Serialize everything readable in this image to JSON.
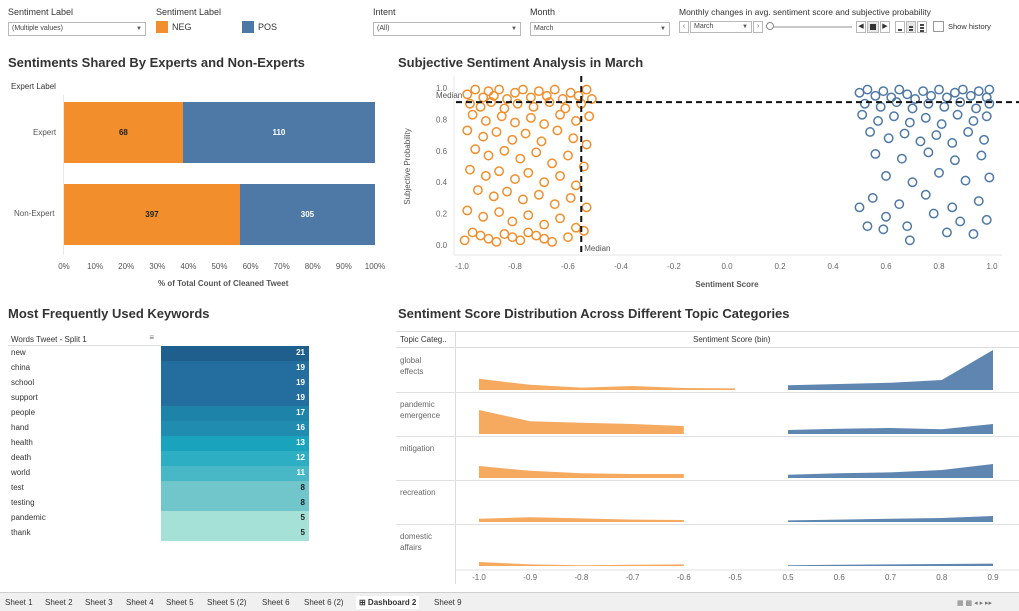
{
  "filters": {
    "sentiment_filter": {
      "label": "Sentiment Label",
      "value": "(Multiple values)"
    },
    "legend": {
      "label": "Sentiment Label",
      "items": [
        {
          "name": "NEG",
          "color": "#f28e2b"
        },
        {
          "name": "POS",
          "color": "#4e79a7"
        }
      ]
    },
    "intent": {
      "label": "Intent",
      "value": "(All)"
    },
    "month": {
      "label": "Month",
      "value": "March"
    },
    "monthly": {
      "label": "Monthly changes in avg. sentiment score and subjective probability",
      "value": "March",
      "show_history": "Show history"
    }
  },
  "panel1": {
    "title": "Sentiments Shared By Experts and Non-Experts",
    "row_header": "Expert Label",
    "xlabel": "% of Total Count of Cleaned Tweet"
  },
  "panel2": {
    "title": "Subjective Sentiment Analysis in March",
    "ylabel": "Subjective Probability",
    "xlabel": "Sentiment Score",
    "median_label_h": "Median",
    "median_label_v": "Median"
  },
  "panel3": {
    "title": "Most Frequently Used Keywords",
    "col_header": "Words Tweet - Split 1"
  },
  "panel4": {
    "title": "Sentiment Score Distribution Across Different Topic Categories",
    "row_header": "Topic Categ..",
    "col_header": "Sentiment Score (bin)",
    "topics": [
      [
        "global",
        "effects"
      ],
      [
        "pandemic",
        "emergence"
      ],
      [
        "mitigation"
      ],
      [
        "recreation"
      ],
      [
        "domestic",
        "affairs"
      ]
    ]
  },
  "chart_data": [
    {
      "type": "bar",
      "title": "Sentiments Shared By Experts and Non-Experts",
      "xlabel": "% of Total Count of Cleaned Tweet",
      "categories": [
        "Expert",
        "Non-Expert"
      ],
      "series": [
        {
          "name": "NEG",
          "values": [
            68,
            397
          ]
        },
        {
          "name": "POS",
          "values": [
            110,
            305
          ]
        }
      ],
      "ticks": [
        "0%",
        "10%",
        "20%",
        "30%",
        "40%",
        "50%",
        "60%",
        "70%",
        "80%",
        "90%",
        "100%"
      ],
      "stacked": "percent"
    },
    {
      "type": "scatter",
      "title": "Subjective Sentiment Analysis in March",
      "xlabel": "Sentiment Score",
      "ylabel": "Subjective Probability",
      "xlim": [
        -1.0,
        1.0
      ],
      "ylim": [
        0.0,
        1.0
      ],
      "x_ticks": [
        "-1.0",
        "-0.8",
        "-0.6",
        "-0.4",
        "-0.2",
        "0.0",
        "0.2",
        "0.4",
        "0.6",
        "0.8",
        "1.0"
      ],
      "y_ticks": [
        "0.0",
        "0.2",
        "0.4",
        "0.6",
        "0.8",
        "1.0"
      ],
      "median_x": -0.55,
      "median_y": 0.91,
      "series": [
        {
          "name": "NEG",
          "points": [
            [
              -0.98,
              0.96
            ],
            [
              -0.95,
              0.99
            ],
            [
              -0.92,
              0.94
            ],
            [
              -0.9,
              0.98
            ],
            [
              -0.88,
              0.95
            ],
            [
              -0.86,
              0.99
            ],
            [
              -0.83,
              0.93
            ],
            [
              -0.8,
              0.97
            ],
            [
              -0.77,
              0.99
            ],
            [
              -0.74,
              0.94
            ],
            [
              -0.71,
              0.98
            ],
            [
              -0.68,
              0.95
            ],
            [
              -0.65,
              0.99
            ],
            [
              -0.62,
              0.93
            ],
            [
              -0.59,
              0.97
            ],
            [
              -0.56,
              0.95
            ],
            [
              -0.53,
              0.99
            ],
            [
              -0.51,
              0.93
            ],
            [
              -0.97,
              0.9
            ],
            [
              -0.93,
              0.88
            ],
            [
              -0.89,
              0.91
            ],
            [
              -0.84,
              0.87
            ],
            [
              -0.79,
              0.9
            ],
            [
              -0.73,
              0.88
            ],
            [
              -0.67,
              0.91
            ],
            [
              -0.61,
              0.87
            ],
            [
              -0.55,
              0.9
            ],
            [
              -0.96,
              0.83
            ],
            [
              -0.91,
              0.79
            ],
            [
              -0.85,
              0.82
            ],
            [
              -0.8,
              0.78
            ],
            [
              -0.74,
              0.81
            ],
            [
              -0.69,
              0.77
            ],
            [
              -0.63,
              0.83
            ],
            [
              -0.57,
              0.79
            ],
            [
              -0.52,
              0.82
            ],
            [
              -0.98,
              0.73
            ],
            [
              -0.92,
              0.69
            ],
            [
              -0.87,
              0.72
            ],
            [
              -0.81,
              0.67
            ],
            [
              -0.76,
              0.71
            ],
            [
              -0.7,
              0.66
            ],
            [
              -0.64,
              0.73
            ],
            [
              -0.58,
              0.68
            ],
            [
              -0.53,
              0.64
            ],
            [
              -0.95,
              0.61
            ],
            [
              -0.9,
              0.57
            ],
            [
              -0.84,
              0.6
            ],
            [
              -0.78,
              0.55
            ],
            [
              -0.72,
              0.59
            ],
            [
              -0.66,
              0.52
            ],
            [
              -0.6,
              0.57
            ],
            [
              -0.54,
              0.5
            ],
            [
              -0.97,
              0.48
            ],
            [
              -0.91,
              0.44
            ],
            [
              -0.86,
              0.47
            ],
            [
              -0.8,
              0.42
            ],
            [
              -0.75,
              0.46
            ],
            [
              -0.69,
              0.4
            ],
            [
              -0.63,
              0.44
            ],
            [
              -0.57,
              0.38
            ],
            [
              -0.94,
              0.35
            ],
            [
              -0.88,
              0.31
            ],
            [
              -0.83,
              0.34
            ],
            [
              -0.77,
              0.29
            ],
            [
              -0.71,
              0.32
            ],
            [
              -0.65,
              0.26
            ],
            [
              -0.59,
              0.3
            ],
            [
              -0.53,
              0.24
            ],
            [
              -0.98,
              0.22
            ],
            [
              -0.92,
              0.18
            ],
            [
              -0.86,
              0.21
            ],
            [
              -0.81,
              0.15
            ],
            [
              -0.75,
              0.19
            ],
            [
              -0.69,
              0.13
            ],
            [
              -0.63,
              0.17
            ],
            [
              -0.57,
              0.11
            ],
            [
              -0.96,
              0.08
            ],
            [
              -0.9,
              0.04
            ],
            [
              -0.84,
              0.07
            ],
            [
              -0.78,
              0.03
            ],
            [
              -0.72,
              0.06
            ],
            [
              -0.66,
              0.02
            ],
            [
              -0.6,
              0.05
            ],
            [
              -0.54,
              0.09
            ],
            [
              -0.99,
              0.03
            ],
            [
              -0.93,
              0.06
            ],
            [
              -0.87,
              0.02
            ],
            [
              -0.81,
              0.05
            ],
            [
              -0.75,
              0.08
            ],
            [
              -0.69,
              0.04
            ]
          ]
        },
        {
          "name": "POS",
          "points": [
            [
              0.5,
              0.97
            ],
            [
              0.53,
              0.99
            ],
            [
              0.56,
              0.95
            ],
            [
              0.59,
              0.98
            ],
            [
              0.62,
              0.94
            ],
            [
              0.65,
              0.99
            ],
            [
              0.68,
              0.96
            ],
            [
              0.71,
              0.93
            ],
            [
              0.74,
              0.98
            ],
            [
              0.77,
              0.95
            ],
            [
              0.8,
              0.99
            ],
            [
              0.83,
              0.94
            ],
            [
              0.86,
              0.97
            ],
            [
              0.89,
              0.99
            ],
            [
              0.92,
              0.95
            ],
            [
              0.95,
              0.98
            ],
            [
              0.98,
              0.94
            ],
            [
              0.99,
              0.99
            ],
            [
              0.52,
              0.9
            ],
            [
              0.58,
              0.88
            ],
            [
              0.64,
              0.91
            ],
            [
              0.7,
              0.87
            ],
            [
              0.76,
              0.9
            ],
            [
              0.82,
              0.88
            ],
            [
              0.88,
              0.91
            ],
            [
              0.94,
              0.87
            ],
            [
              0.99,
              0.9
            ],
            [
              0.51,
              0.83
            ],
            [
              0.57,
              0.79
            ],
            [
              0.63,
              0.82
            ],
            [
              0.69,
              0.78
            ],
            [
              0.75,
              0.81
            ],
            [
              0.81,
              0.77
            ],
            [
              0.87,
              0.83
            ],
            [
              0.93,
              0.79
            ],
            [
              0.98,
              0.82
            ],
            [
              0.54,
              0.72
            ],
            [
              0.61,
              0.68
            ],
            [
              0.67,
              0.71
            ],
            [
              0.73,
              0.66
            ],
            [
              0.79,
              0.7
            ],
            [
              0.85,
              0.65
            ],
            [
              0.91,
              0.72
            ],
            [
              0.97,
              0.67
            ],
            [
              0.56,
              0.58
            ],
            [
              0.66,
              0.55
            ],
            [
              0.76,
              0.59
            ],
            [
              0.86,
              0.54
            ],
            [
              0.96,
              0.57
            ],
            [
              0.6,
              0.44
            ],
            [
              0.7,
              0.4
            ],
            [
              0.8,
              0.46
            ],
            [
              0.9,
              0.41
            ],
            [
              0.99,
              0.43
            ],
            [
              0.55,
              0.3
            ],
            [
              0.65,
              0.26
            ],
            [
              0.75,
              0.32
            ],
            [
              0.85,
              0.24
            ],
            [
              0.95,
              0.28
            ],
            [
              0.5,
              0.24
            ],
            [
              0.6,
              0.18
            ],
            [
              0.68,
              0.12
            ],
            [
              0.78,
              0.2
            ],
            [
              0.88,
              0.15
            ],
            [
              0.98,
              0.16
            ],
            [
              0.53,
              0.12
            ],
            [
              0.59,
              0.1
            ],
            [
              0.69,
              0.03
            ],
            [
              0.83,
              0.08
            ],
            [
              0.93,
              0.07
            ]
          ]
        }
      ]
    },
    {
      "type": "heatmap",
      "title": "Most Frequently Used Keywords",
      "categories": [
        "new",
        "china",
        "school",
        "support",
        "people",
        "hand",
        "health",
        "death",
        "world",
        "test",
        "testing",
        "pandemic",
        "thank"
      ],
      "values": [
        21,
        19,
        19,
        19,
        17,
        16,
        13,
        12,
        11,
        8,
        8,
        5,
        5
      ],
      "colors": [
        "#1f5f8e",
        "#236e9e",
        "#236e9e",
        "#236e9e",
        "#1d83a8",
        "#1f8cb0",
        "#1aa3bc",
        "#2eaec2",
        "#48b8c6",
        "#71c6cc",
        "#71c6cc",
        "#a5e1d7",
        "#a5e1d7"
      ]
    },
    {
      "type": "area",
      "title": "Sentiment Score Distribution Across Different Topic Categories",
      "xlabel": "Sentiment Score (bin)",
      "x_ticks": [
        "-1.0",
        "-0.9",
        "-0.8",
        "-0.7",
        "-0.6",
        "-0.5",
        "0.5",
        "0.6",
        "0.7",
        "0.8",
        "0.9"
      ],
      "series": [
        {
          "name": "global effects",
          "neg": [
            [
              -1.0,
              0.28
            ],
            [
              -0.9,
              0.13
            ],
            [
              -0.8,
              0.06
            ],
            [
              -0.7,
              0.1
            ],
            [
              -0.6,
              0.05
            ],
            [
              -0.5,
              0.04
            ]
          ],
          "pos": [
            [
              0.5,
              0.12
            ],
            [
              0.6,
              0.15
            ],
            [
              0.7,
              0.18
            ],
            [
              0.8,
              0.25
            ],
            [
              0.9,
              1.0
            ]
          ]
        },
        {
          "name": "pandemic emergence",
          "neg": [
            [
              -1.0,
              0.6
            ],
            [
              -0.9,
              0.32
            ],
            [
              -0.8,
              0.28
            ],
            [
              -0.7,
              0.25
            ],
            [
              -0.6,
              0.2
            ]
          ],
          "pos": [
            [
              0.5,
              0.1
            ],
            [
              0.6,
              0.13
            ],
            [
              0.7,
              0.15
            ],
            [
              0.8,
              0.12
            ],
            [
              0.9,
              0.25
            ]
          ]
        },
        {
          "name": "mitigation",
          "neg": [
            [
              -1.0,
              0.3
            ],
            [
              -0.9,
              0.18
            ],
            [
              -0.8,
              0.12
            ],
            [
              -0.7,
              0.1
            ],
            [
              -0.6,
              0.1
            ]
          ],
          "pos": [
            [
              0.5,
              0.08
            ],
            [
              0.6,
              0.12
            ],
            [
              0.7,
              0.14
            ],
            [
              0.8,
              0.2
            ],
            [
              0.9,
              0.35
            ]
          ]
        },
        {
          "name": "recreation",
          "neg": [
            [
              -1.0,
              0.08
            ],
            [
              -0.9,
              0.12
            ],
            [
              -0.8,
              0.09
            ],
            [
              -0.7,
              0.06
            ],
            [
              -0.6,
              0.05
            ]
          ],
          "pos": [
            [
              0.5,
              0.04
            ],
            [
              0.6,
              0.06
            ],
            [
              0.7,
              0.08
            ],
            [
              0.8,
              0.1
            ],
            [
              0.9,
              0.15
            ]
          ]
        },
        {
          "name": "domestic affairs",
          "neg": [
            [
              -1.0,
              0.1
            ],
            [
              -0.9,
              0.04
            ],
            [
              -0.8,
              0.02
            ],
            [
              -0.7,
              0.03
            ],
            [
              -0.6,
              0.04
            ]
          ],
          "pos": [
            [
              0.5,
              0.02
            ],
            [
              0.6,
              0.03
            ],
            [
              0.7,
              0.04
            ],
            [
              0.8,
              0.05
            ],
            [
              0.9,
              0.06
            ]
          ]
        }
      ]
    }
  ],
  "tabs": [
    "Sheet 1",
    "Sheet 2",
    "Sheet 3",
    "Sheet 4",
    "Sheet 5",
    "Sheet 5 (2)",
    "Sheet 6",
    "Sheet 6 (2)",
    "Dashboard 2",
    "Sheet 9"
  ],
  "active_tab": "Dashboard 2"
}
